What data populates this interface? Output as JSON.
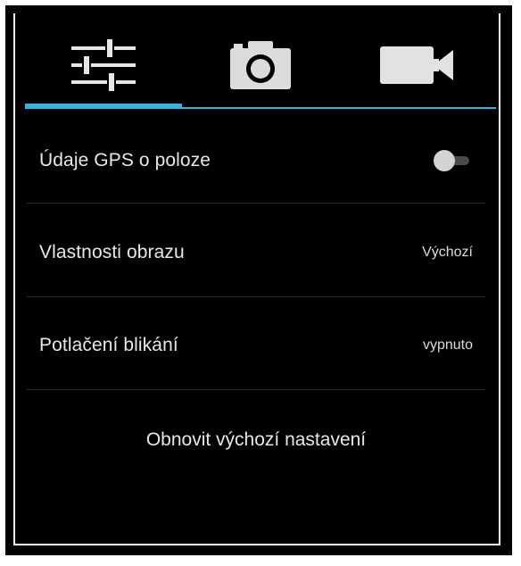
{
  "tabs": [
    {
      "icon": "settings-sliders-icon",
      "active": true
    },
    {
      "icon": "camera-icon",
      "active": false
    },
    {
      "icon": "video-camera-icon",
      "active": false
    }
  ],
  "accent_color": "#33b5e5",
  "settings": {
    "gps": {
      "label": "Údaje GPS o poloze",
      "toggle_on": false
    },
    "image_properties": {
      "label": "Vlastnosti obrazu",
      "value": "Výchozí"
    },
    "flicker": {
      "label": "Potlačení blikání",
      "value": "vypnuto"
    },
    "reset_label": "Obnovit výchozí nastavení"
  }
}
